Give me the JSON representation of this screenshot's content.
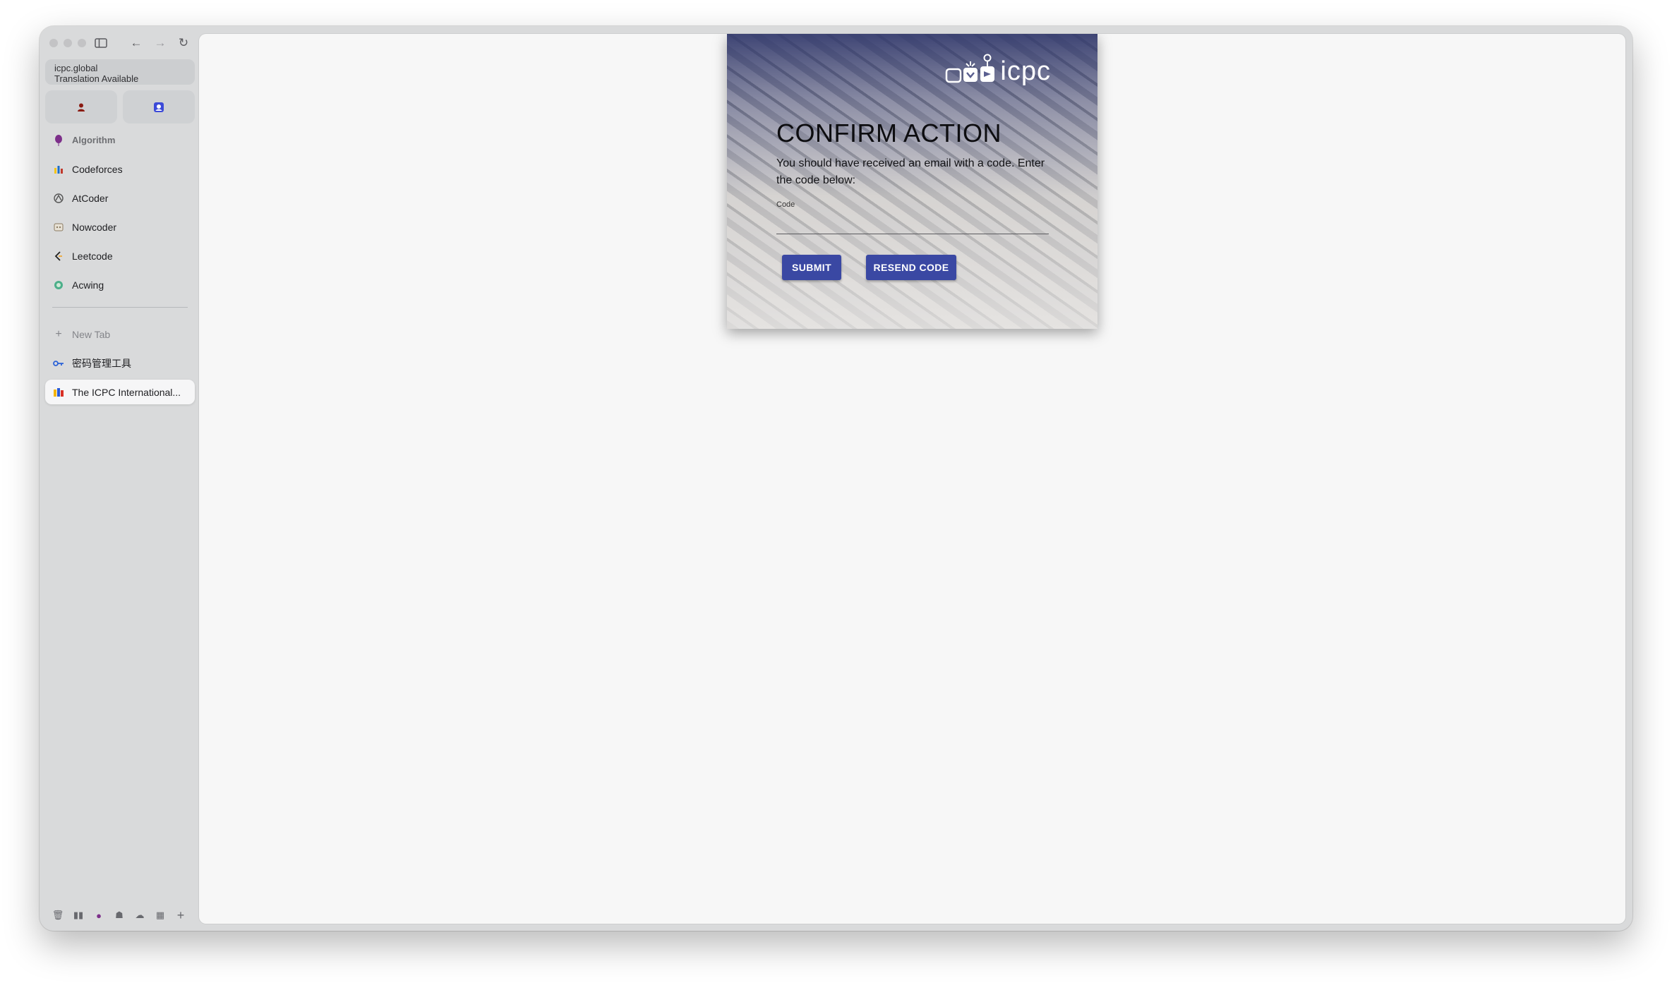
{
  "browser": {
    "url": "icpc.global",
    "url_subtitle": "Translation Available"
  },
  "sidebar": {
    "folder_label": "Algorithm",
    "folder_items": [
      {
        "label": "Codeforces",
        "icon": "codeforces-icon"
      },
      {
        "label": "AtCoder",
        "icon": "atcoder-icon"
      },
      {
        "label": "Nowcoder",
        "icon": "nowcoder-icon"
      },
      {
        "label": "Leetcode",
        "icon": "leetcode-icon"
      },
      {
        "label": "Acwing",
        "icon": "acwing-icon"
      }
    ],
    "new_tab_label": "New Tab",
    "tabs": [
      {
        "label": "密码管理工具",
        "icon": "key-icon"
      },
      {
        "label": "The ICPC International...",
        "icon": "icpc-favicon",
        "active": true
      }
    ]
  },
  "page": {
    "logo_text": "icpc",
    "title": "CONFIRM ACTION",
    "description": "You should have received an email with a code. Enter the code below:",
    "code_label": "Code",
    "code_value": "",
    "submit_label": "SUBMIT",
    "resend_label": "RESEND CODE",
    "accent_color": "#3a48a3"
  }
}
